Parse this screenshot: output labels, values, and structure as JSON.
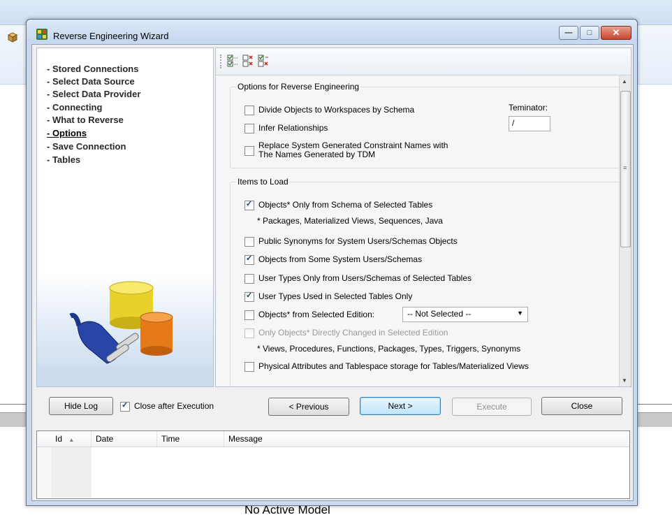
{
  "window": {
    "title": "Reverse Engineering Wizard",
    "buttons": {
      "minimize": "—",
      "maximize": "□",
      "close": "✕"
    }
  },
  "nav": {
    "items": [
      {
        "label": "- Stored Connections",
        "active": false
      },
      {
        "label": "- Select Data Source",
        "active": false
      },
      {
        "label": "- Select Data Provider",
        "active": false
      },
      {
        "label": "- Connecting",
        "active": false
      },
      {
        "label": "- What to Reverse",
        "active": false
      },
      {
        "label": "- Options",
        "active": true
      },
      {
        "label": "- Save Connection",
        "active": false
      },
      {
        "label": "- Tables",
        "active": false
      }
    ]
  },
  "toolbar": {
    "icons": [
      "check-all-icon",
      "uncheck-all-icon",
      "invert-selection-icon"
    ]
  },
  "options_group": {
    "label": "Options for Reverse Engineering",
    "divide_objects": {
      "label": "Divide Objects to Workspaces by Schema",
      "checked": false
    },
    "infer_relationships": {
      "label": "Infer Relationships",
      "checked": false
    },
    "replace_names": {
      "line1": "Replace System Generated Constraint Names with",
      "line2": "The Names Generated by TDM",
      "checked": false
    },
    "terminator_label": "Teminator:",
    "terminator_value": "/"
  },
  "items_group": {
    "label": "Items to Load",
    "objects_schema": {
      "label": "Objects* Only from Schema of Selected Tables",
      "checked": true
    },
    "objects_schema_note": "* Packages, Materialized Views, Sequences, Java",
    "public_synonyms": {
      "label": "Public Synonyms for System Users/Schemas Objects",
      "checked": false
    },
    "objects_system": {
      "label": "Objects from Some System Users/Schemas",
      "checked": true
    },
    "user_types_only": {
      "label": "User Types Only from Users/Schemas of Selected Tables",
      "checked": false
    },
    "user_types_used": {
      "label": "User Types Used in Selected Tables Only",
      "checked": true
    },
    "objects_edition": {
      "label": "Objects* from Selected Edition:",
      "checked": false
    },
    "edition_select": "-- Not Selected --",
    "only_objects_changed": {
      "label": "Only Objects* Directly Changed in Selected Edition",
      "checked": false
    },
    "edition_note": "* Views, Procedures, Functions, Packages, Types, Triggers, Synonyms",
    "physical_attrs": {
      "label": "Physical Attributes and Tablespace storage for Tables/Materialized Views",
      "checked": false
    }
  },
  "footer": {
    "hide_log": "Hide Log",
    "close_after_execution": {
      "label": "Close after Execution",
      "checked": true
    },
    "previous": "< Previous",
    "next": "Next >",
    "execute": "Execute",
    "close": "Close"
  },
  "log": {
    "columns": [
      "Id",
      "Date",
      "Time",
      "Message"
    ],
    "sort_indicator": "▲"
  },
  "status": {
    "text": "No Active Model"
  }
}
